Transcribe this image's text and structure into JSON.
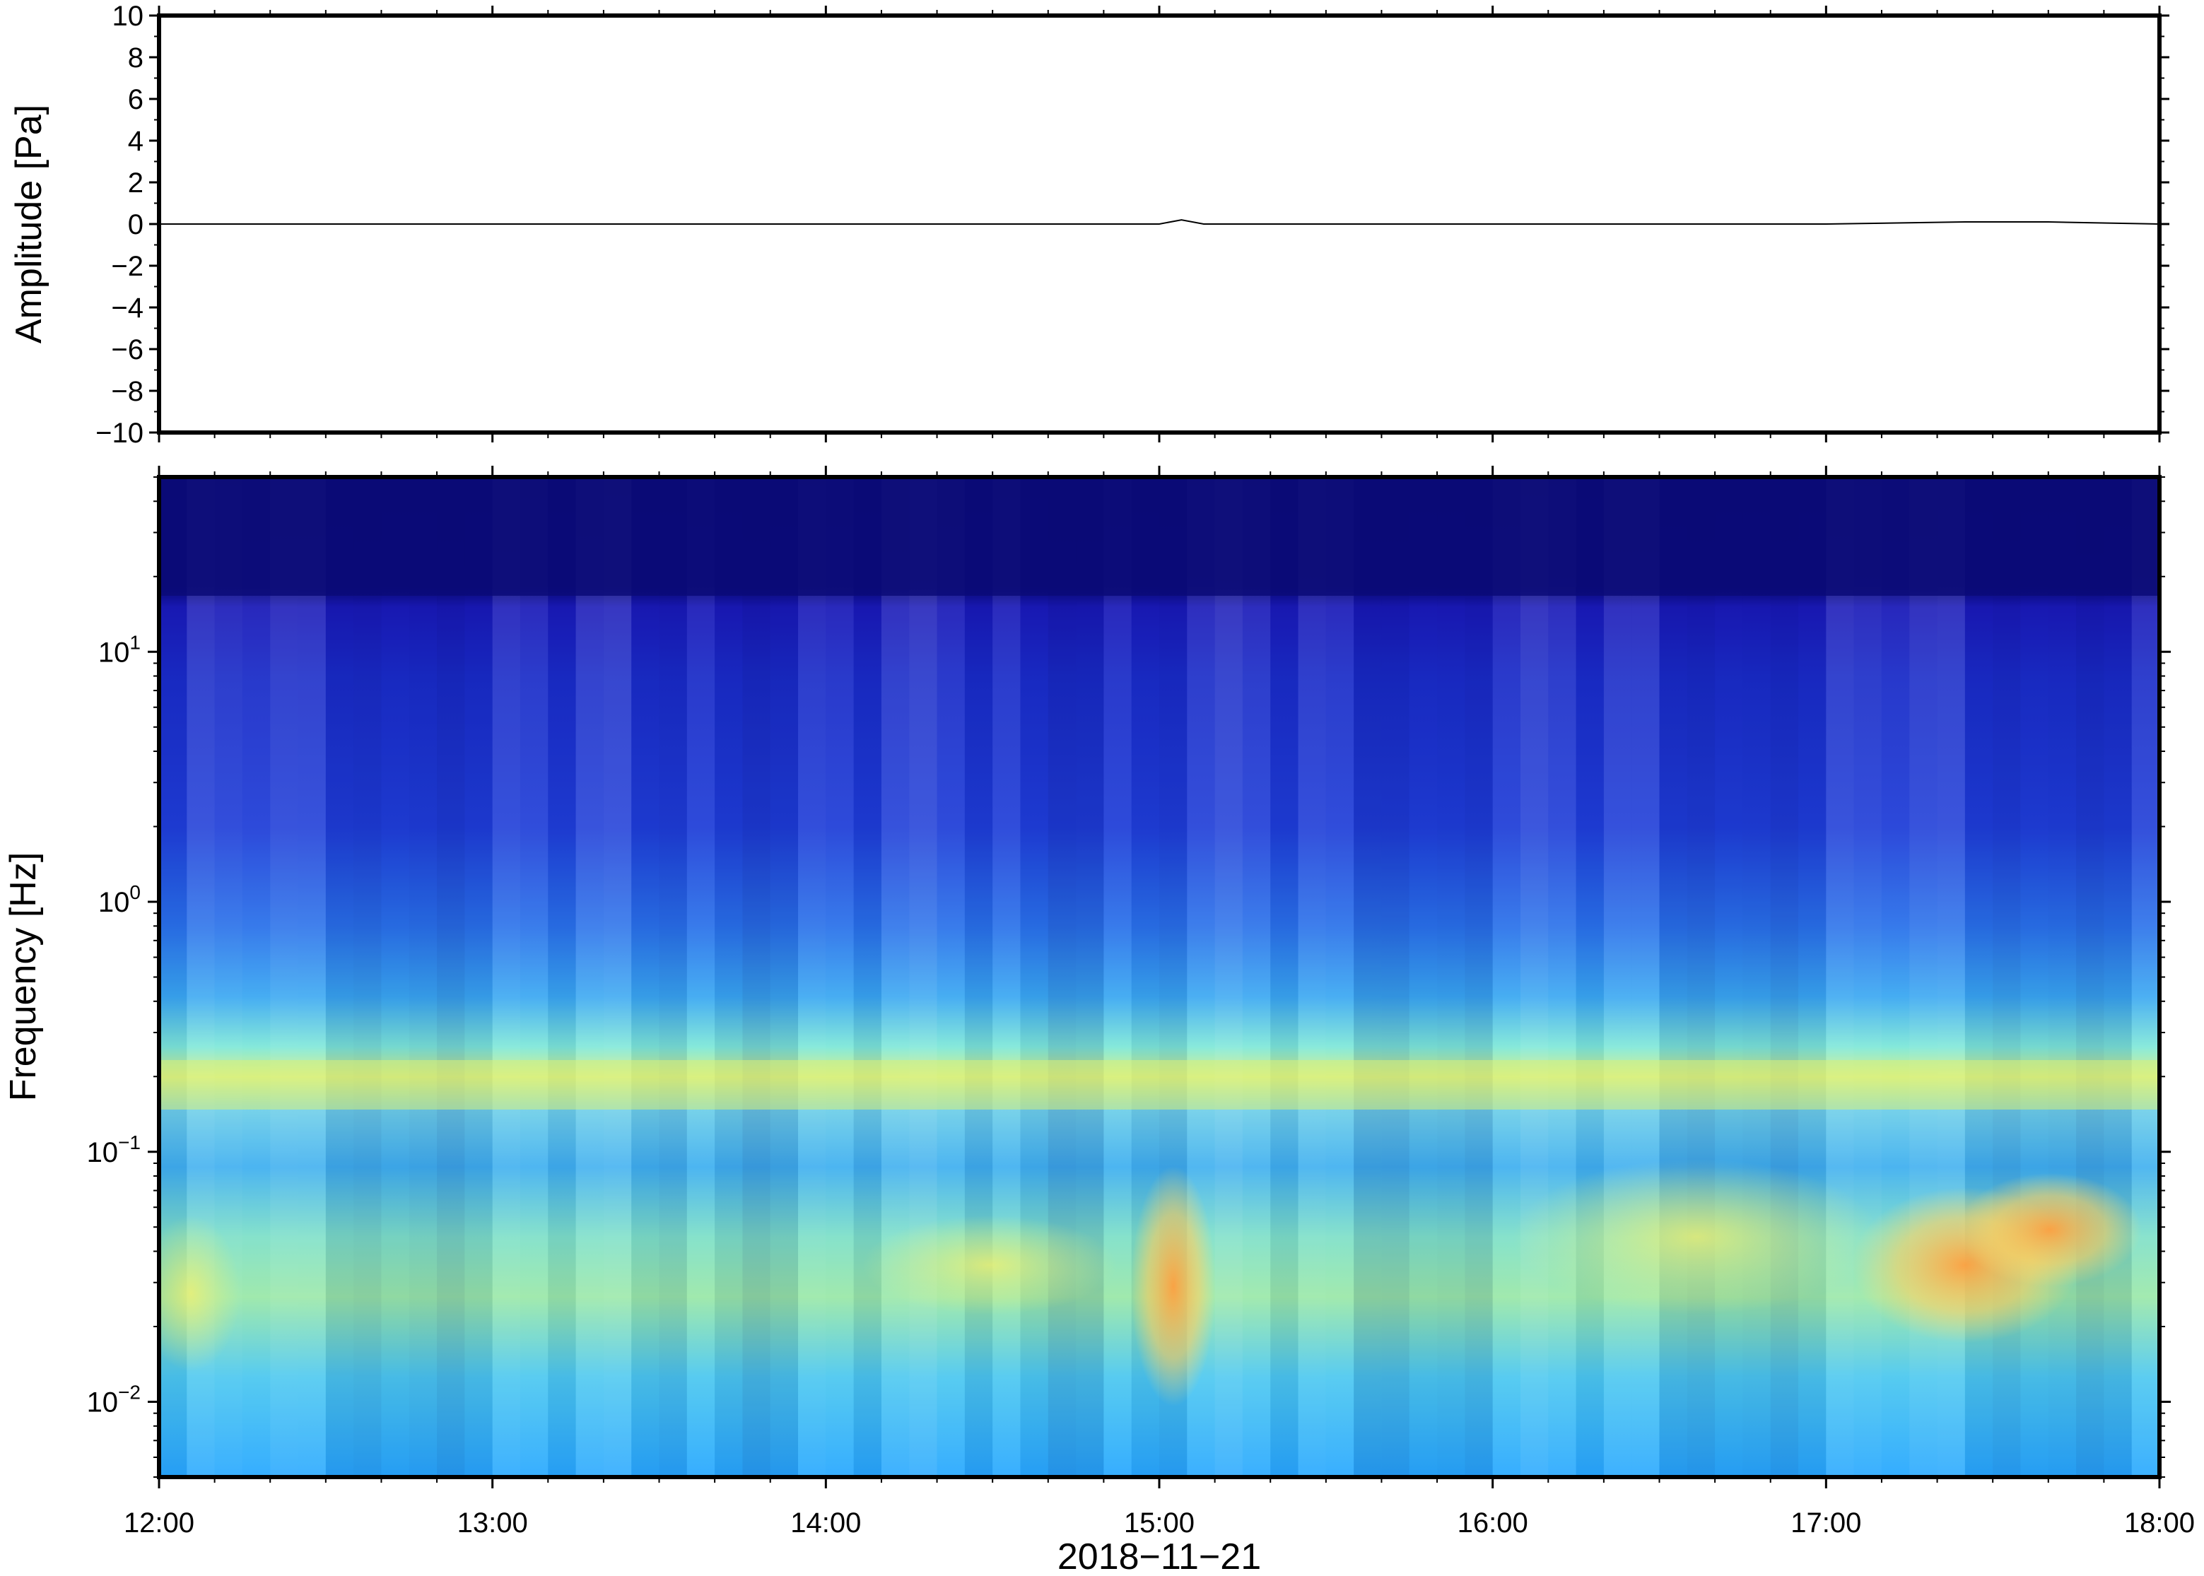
{
  "chart_data": [
    {
      "type": "line",
      "ylabel": "Amplitude [Pa]",
      "ylim": [
        -10,
        10
      ],
      "yticks": [
        10,
        8,
        6,
        4,
        2,
        0,
        -2,
        -4,
        -6,
        -8,
        -10
      ],
      "ytick_labels": [
        "10",
        "8",
        "6",
        "4",
        "2",
        "0",
        "−2",
        "−4",
        "−6",
        "−8",
        "−10"
      ],
      "x_range": [
        "2018-11-21 12:00",
        "2018-11-21 18:00"
      ],
      "series": [
        {
          "x": [
            "12:00",
            "13:00",
            "14:00",
            "15:00",
            "15:04",
            "15:08",
            "16:00",
            "17:00",
            "17:25",
            "17:30",
            "17:40",
            "18:00"
          ],
          "values": [
            0,
            0,
            0,
            0,
            0.2,
            0,
            0,
            0,
            0.1,
            0.1,
            0.1,
            0
          ]
        }
      ],
      "line_color": "#000000",
      "grid": false
    },
    {
      "type": "heatmap",
      "ylabel": "Frequency [Hz]",
      "yscale": "log",
      "ylim": [
        0.005,
        50
      ],
      "yticks": [
        0.01,
        0.1,
        1,
        10
      ],
      "ytick_labels": [
        {
          "base": "10",
          "exp": "−2"
        },
        {
          "base": "10",
          "exp": "−1"
        },
        {
          "base": "10",
          "exp": "0"
        },
        {
          "base": "10",
          "exp": "1"
        }
      ],
      "xlabel": "2018−11−21",
      "x_range": [
        "12:00",
        "18:00"
      ],
      "xtick_labels": [
        "12:00",
        "13:00",
        "14:00",
        "15:00",
        "16:00",
        "17:00",
        "18:00"
      ],
      "colormap": "jet",
      "color_low": "#00007f",
      "color_high": "#ffa000",
      "features": [
        {
          "description": "high-frequency floor",
          "freq_range_hz": [
            17,
            50
          ],
          "color": "#0a0a78"
        },
        {
          "description": "microbarom band",
          "center_hz": 0.17,
          "color": "#d8f078"
        },
        {
          "description": "event",
          "time": "15:05",
          "freq_range_hz": [
            0.015,
            0.08
          ],
          "color": "#ffb050"
        },
        {
          "description": "event",
          "time_range": [
            "17:15",
            "18:00"
          ],
          "freq_range_hz": [
            0.02,
            0.08
          ],
          "color": "#ffa050"
        }
      ],
      "grid": false
    }
  ]
}
